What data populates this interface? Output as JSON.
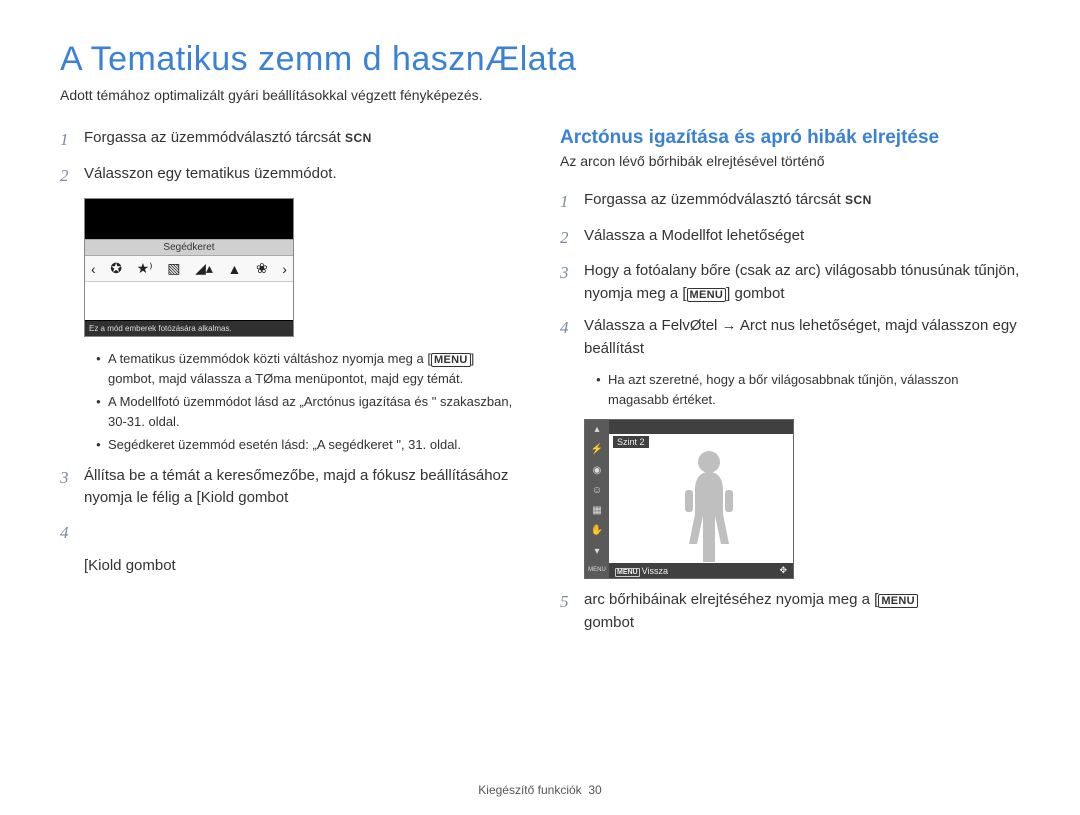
{
  "title": "A Tematikus  zemm d hasznÆlata",
  "subtitle": "Adott témához optimalizált gyári beállításokkal végzett fényképezés.",
  "left": {
    "step1_prefix": "Forgassa az üzemmódválasztó tárcsát ",
    "step1_badge": "SCN",
    "step2": "Válasszon egy tematikus üzemmódot.",
    "shot1": {
      "bar_title": "Segédkeret",
      "desc": "Ez a mód emberek fotózására alkalmas."
    },
    "bullets": [
      "A tematikus üzemmódok közti váltáshoz nyomja meg a [MENU] gombot, majd válassza a TØma menüpontot, majd egy témát.",
      "A Modellfotó üzemmódot lásd az „Arctónus igazítása és \" szakaszban, 30-31. oldal.",
      "Segédkeret üzemmód esetén lásd: „A segédkeret \", 31. oldal."
    ],
    "step3": "Állítsa be a témát a keresőmezőbe, majd a fókusz beállításához nyomja le félig a [Kiold gombot",
    "step4_extra": "[Kiold gombot"
  },
  "right": {
    "section_title": "Arctónus igazítása és apró hibák elrejtése",
    "section_desc": "Az arcon lévő bőrhibák elrejtésével történő",
    "step1_prefix": "Forgassa az üzemmódválasztó tárcsát ",
    "step1_badge": "SCN",
    "step2": "Válassza a Modellfot    lehetőséget",
    "step3_a": "Hogy a fotóalany bőre (csak az arc) világosabb tónusúnak tűnjön, nyomja meg a [",
    "step3_menu": "MENU",
    "step3_b": "] gombot",
    "step4": "Válassza a FelvØtel → Arct nus lehetőséget, majd válasszon egy beállítást",
    "bullet": "Ha azt szeretné, hogy a bőr világosabbnak tűnjön, válasszon magasabb értéket.",
    "shot2": {
      "level": "Szint 2",
      "back": "Vissza",
      "move_icon": "✥"
    },
    "step5_a": " arc bőrhibáinak elrejtéséhez nyomja meg a [",
    "step5_menu": "MENU",
    "step5_b": "gombot"
  },
  "footer": {
    "section": "Kiegészítő funkciók",
    "page": "30"
  }
}
